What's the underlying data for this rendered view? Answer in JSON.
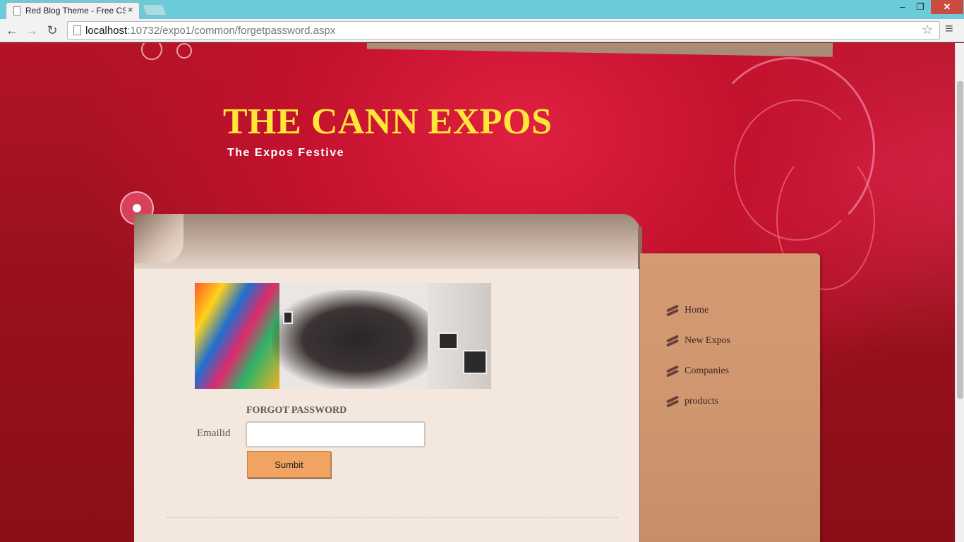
{
  "browser": {
    "tab_title": "Red Blog Theme - Free CS",
    "tab_close": "×",
    "url_host": "localhost",
    "url_path": ":10732/expo1/common/forgetpassword.aspx",
    "back_glyph": "←",
    "forward_glyph": "→",
    "reload_glyph": "↻",
    "star_glyph": "☆",
    "menu_glyph": "≡",
    "minimize_glyph": "–",
    "maximize_glyph": "❐",
    "close_glyph": "✕"
  },
  "site": {
    "title": "THE CANN EXPOS",
    "tagline": "The Expos Festive"
  },
  "form": {
    "heading": "FORGOT PASSWORD",
    "email_label": "Emailid",
    "email_value": "",
    "submit_label": "Sumbit"
  },
  "sidebar": {
    "items": [
      {
        "label": "Home",
        "icon": "bird-icon"
      },
      {
        "label": "New Expos",
        "icon": "bird-icon"
      },
      {
        "label": "Companies",
        "icon": "bird-icon"
      },
      {
        "label": "products",
        "icon": "bird-icon"
      }
    ]
  },
  "colors": {
    "title_yellow": "#ffe638",
    "page_red": "#b31426",
    "button_orange": "#f1a361",
    "sidebar_tan": "#cf9670",
    "panel_cream": "#f4e7de"
  }
}
